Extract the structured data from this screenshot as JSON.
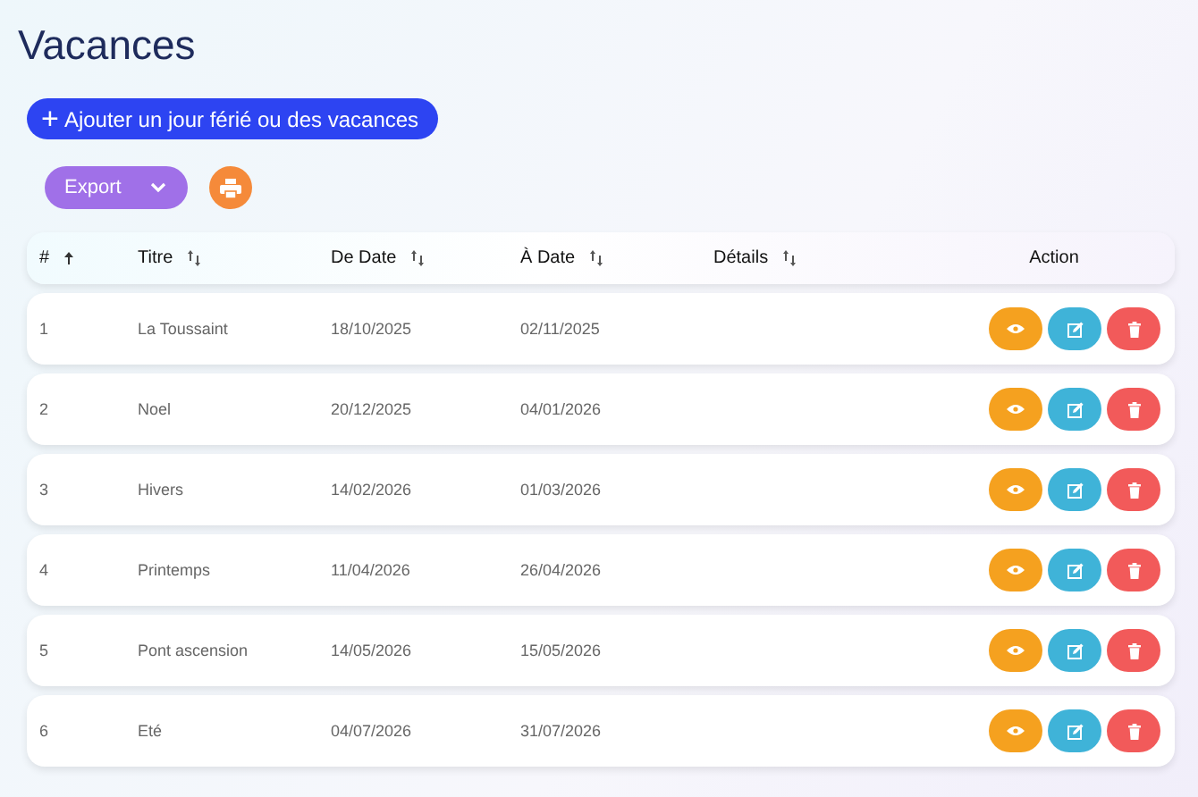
{
  "title": "Vacances",
  "add_button": {
    "icon": "+",
    "label": "Ajouter un jour férié ou des vacances"
  },
  "export_button": {
    "label": "Export"
  },
  "table": {
    "columns": [
      {
        "label": "#",
        "kind": "sorted"
      },
      {
        "label": "Titre",
        "kind": "sortable"
      },
      {
        "label": "De Date",
        "kind": "sortable"
      },
      {
        "label": "À Date",
        "kind": "sortable"
      },
      {
        "label": "Détails",
        "kind": "sortable"
      },
      {
        "label": "Action",
        "kind": "plain"
      }
    ],
    "rows": [
      {
        "index": "1",
        "title": "La Toussaint",
        "from": "18/10/2025",
        "to": "02/11/2025"
      },
      {
        "index": "2",
        "title": "Noel",
        "from": "20/12/2025",
        "to": "04/01/2026"
      },
      {
        "index": "3",
        "title": "Hivers",
        "from": "14/02/2026",
        "to": "01/03/2026"
      },
      {
        "index": "4",
        "title": "Printemps",
        "from": "11/04/2026",
        "to": "26/04/2026"
      },
      {
        "index": "5",
        "title": "Pont ascension",
        "from": "14/05/2026",
        "to": "15/05/2026"
      },
      {
        "index": "6",
        "title": "Eté",
        "from": "04/07/2026",
        "to": "31/07/2026"
      }
    ]
  }
}
